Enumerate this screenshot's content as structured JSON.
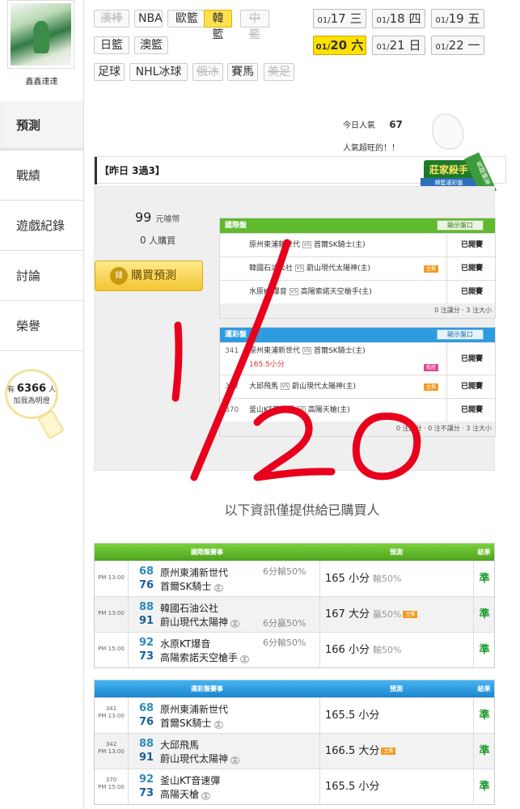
{
  "user": {
    "name": "鑫鑫達達"
  },
  "sidebar": {
    "items": [
      {
        "label": "預測",
        "active": true
      },
      {
        "label": "戰績"
      },
      {
        "label": "遊戲紀錄"
      },
      {
        "label": "討論"
      },
      {
        "label": "榮譽"
      }
    ],
    "fans": {
      "prefix": "有",
      "count": "6366",
      "unit": "人",
      "cta": "加我為明燈"
    }
  },
  "sports": [
    {
      "label": "澳棒",
      "state": "disabled"
    },
    {
      "label": "NBA"
    },
    {
      "label": "歐籃"
    },
    {
      "label": "韓籃",
      "state": "active"
    },
    {
      "label": "中籃",
      "state": "disabled"
    },
    {
      "label": "日籃"
    },
    {
      "label": "澳籃"
    },
    {
      "label": "足球"
    },
    {
      "label": "NHL冰球"
    },
    {
      "label": "俄冰",
      "state": "disabled"
    },
    {
      "label": "賽馬"
    },
    {
      "label": "美足",
      "state": "disabled"
    }
  ],
  "dates": [
    {
      "month": "01/",
      "day": "17",
      "weekday": "三"
    },
    {
      "month": "01/",
      "day": "18",
      "weekday": "四"
    },
    {
      "month": "01/",
      "day": "19",
      "weekday": "五"
    },
    {
      "month": "01/",
      "day": "20",
      "weekday": "六",
      "active": true
    },
    {
      "month": "01/",
      "day": "21",
      "weekday": "日"
    },
    {
      "month": "01/",
      "day": "22",
      "weekday": "一"
    }
  ],
  "popularity": {
    "label": "今日人氣",
    "value": "67",
    "note": "人氣超旺的！！"
  },
  "yesterday": {
    "label": "【昨日 3過3】"
  },
  "badge": {
    "title": "莊家殺手",
    "subtitle": "韓籃運彩盤",
    "ribbon": "長期勝率"
  },
  "purchase": {
    "price": "99",
    "price_unit": "元噱幣",
    "buyers_count": "0",
    "buyers_label": "人購買",
    "button": "購買預測"
  },
  "intl_odds": {
    "header": "國際盤",
    "show_button": "顯示盤口",
    "rows": [
      {
        "num": "",
        "away": "原州東浦新世代",
        "vs": "VS",
        "home": "首爾SK騎士(主)",
        "tag": "",
        "status": "已開賽"
      },
      {
        "num": "",
        "away": "韓國石油公社",
        "vs": "VS",
        "home": "蔚山現代太陽神(主)",
        "tag": "主推",
        "status": "已開賽"
      },
      {
        "num": "",
        "away": "水原KT爆音",
        "vs": "VS",
        "home": "高陽索諾天空槍手(主)",
        "tag": "",
        "status": "已開賽"
      }
    ],
    "footer": "0 注讓分 ‧ 3 注大小"
  },
  "lottery_odds": {
    "header": "運彩盤",
    "show_button": "顯示盤口",
    "rows": [
      {
        "num": "341",
        "away": "原州東浦新世代",
        "vs": "VS",
        "home": "首爾SK騎士(主)",
        "sub": "165.5小分",
        "tag": "殺莊",
        "status": "已開賽"
      },
      {
        "num": "342",
        "away": "大邱飛馬",
        "vs": "VS",
        "home": "蔚山現代太陽神(主)",
        "tag": "主推",
        "status": "已開賽"
      },
      {
        "num": "370",
        "away": "釜山KT音速彈",
        "vs": "VS",
        "home": "高陽天槍(主)",
        "tag": "",
        "status": "已開賽"
      }
    ],
    "footer": "0 注讓分 ‧ 0 注不讓分 ‧ 3 注大小"
  },
  "notice": "以下資訊僅提供給已購買人",
  "intl_results": {
    "headers": {
      "match": "國際盤賽事",
      "prediction": "預測",
      "result": "結果"
    },
    "rows": [
      {
        "time": "PM 13:00",
        "num": "",
        "s1": "68",
        "s2": "76",
        "away": "原州東浦新世代",
        "home": "首爾SK騎士",
        "home_mark": "主",
        "hcap": "6分輸50%",
        "hcap_row": 1,
        "pred": "165 小分",
        "pred_note": "輸50%",
        "tag": "",
        "result": "準"
      },
      {
        "time": "PM 13:00",
        "num": "",
        "s1": "88",
        "s2": "91",
        "away": "韓國石油公社",
        "home": "蔚山現代太陽神",
        "home_mark": "主",
        "hcap": "6分贏50%",
        "hcap_row": 2,
        "pred": "167 大分",
        "pred_note": "贏50%",
        "tag": "主推",
        "result": "準"
      },
      {
        "time": "PM 15:00",
        "num": "",
        "s1": "92",
        "s2": "73",
        "away": "水原KT爆音",
        "home": "高陽索諾天空槍手",
        "home_mark": "主",
        "hcap": "6分輸50%",
        "hcap_row": 1,
        "pred": "166 小分",
        "pred_note": "輸50%",
        "tag": "",
        "result": "準"
      }
    ]
  },
  "lottery_results": {
    "headers": {
      "match": "運彩盤賽事",
      "prediction": "預測",
      "result": "結果"
    },
    "rows": [
      {
        "time": "PM 13:00",
        "num": "341",
        "s1": "68",
        "s2": "76",
        "away": "原州東浦新世代",
        "home": "首爾SK騎士",
        "home_mark": "主",
        "pred": "165.5 小分",
        "tag": "",
        "result": "準"
      },
      {
        "time": "PM 13:00",
        "num": "342",
        "s1": "88",
        "s2": "91",
        "away": "大邱飛馬",
        "home": "蔚山現代太陽神",
        "home_mark": "主",
        "pred": "166.5 大分",
        "tag": "主推",
        "result": "準"
      },
      {
        "time": "PM 15:00",
        "num": "370",
        "s1": "92",
        "s2": "73",
        "away": "釜山KT音速彈",
        "home": "高陽天槍",
        "home_mark": "主",
        "pred": "165.5 小分",
        "tag": "",
        "result": "準"
      }
    ]
  },
  "handwriting": {
    "text": "1/20",
    "color": "#e8001c"
  }
}
